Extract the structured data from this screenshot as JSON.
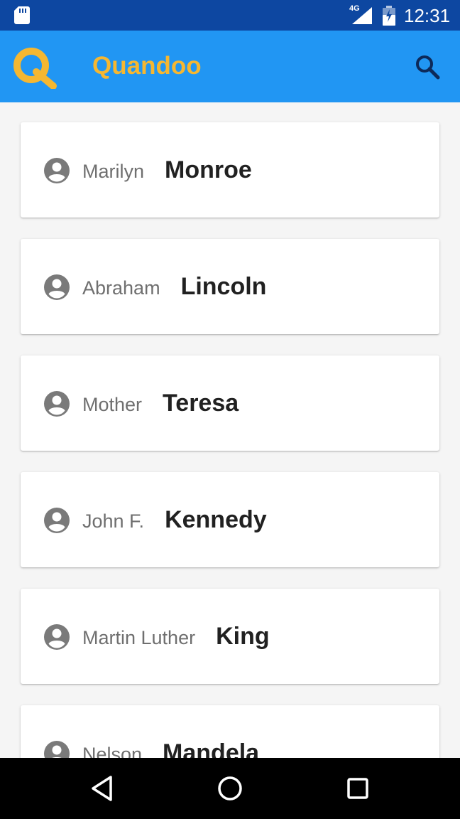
{
  "status_bar": {
    "network": "4G",
    "time": "12:31",
    "icons": [
      "sd-card-icon",
      "signal-icon",
      "battery-icon"
    ]
  },
  "app_bar": {
    "title": "Quandoo",
    "logo_icon": "quandoo-q-logo",
    "search_icon": "search-icon",
    "colors": {
      "background": "#2196f3",
      "title": "#f5b731"
    }
  },
  "people": [
    {
      "first": "Marilyn",
      "last": "Monroe"
    },
    {
      "first": "Abraham",
      "last": "Lincoln"
    },
    {
      "first": "Mother",
      "last": "Teresa"
    },
    {
      "first": "John F.",
      "last": "Kennedy"
    },
    {
      "first": "Martin Luther",
      "last": "King"
    },
    {
      "first": "Nelson",
      "last": "Mandela"
    }
  ],
  "nav_bar": {
    "icons": [
      "back-icon",
      "home-icon",
      "recents-icon"
    ]
  }
}
